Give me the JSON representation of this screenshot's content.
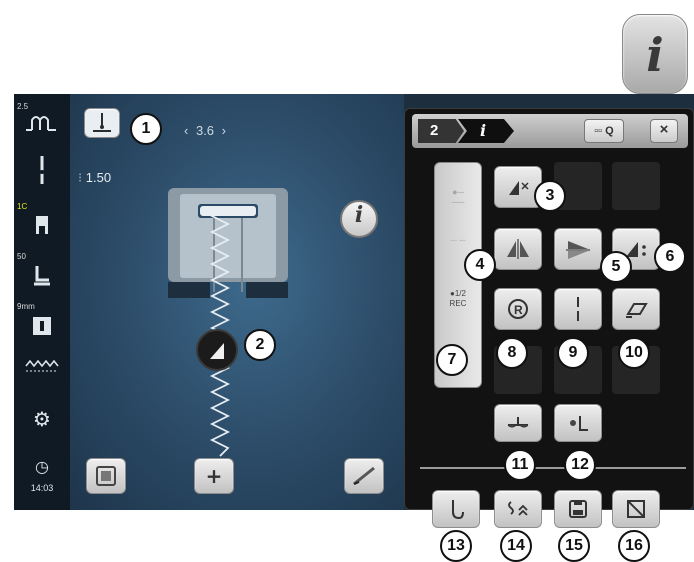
{
  "info_button": {
    "label": "i"
  },
  "sidebar": {
    "items": [
      {
        "top_label": "2.5",
        "icon": "stitch-width-icon",
        "glyph": "-ΩΩ-"
      },
      {
        "top_label": "",
        "icon": "needle-icon",
        "glyph": "|"
      },
      {
        "top_label": "1C",
        "icon": "presser-foot-icon",
        "glyph": "R"
      },
      {
        "top_label": "50",
        "icon": "needle-stop-icon",
        "glyph": "⬇"
      },
      {
        "top_label": "9mm",
        "icon": "stitch-plate-icon",
        "glyph": "▦"
      },
      {
        "top_label": "",
        "icon": "feed-dog-icon",
        "glyph": "ʌʌʌʌ"
      },
      {
        "top_label": "",
        "icon": "setup-gear-icon",
        "glyph": "⚙"
      },
      {
        "top_label": "",
        "icon": "clock-icon",
        "glyph": "◷",
        "time": "14:03"
      }
    ]
  },
  "workspace": {
    "stitch_length": "3.6",
    "needle_width": "1.50",
    "stitch_length_left_arrow": "‹",
    "stitch_length_right_arrow": "›"
  },
  "panel": {
    "tab_number": "2",
    "tab_info": "i",
    "zoom_label": "▫▫ Q",
    "close_label": "×",
    "rec_label": "●1/2\nREC"
  },
  "callouts": [
    "1",
    "2",
    "3",
    "4",
    "5",
    "6",
    "7",
    "8",
    "9",
    "10",
    "11",
    "12",
    "13",
    "14",
    "15",
    "16"
  ]
}
